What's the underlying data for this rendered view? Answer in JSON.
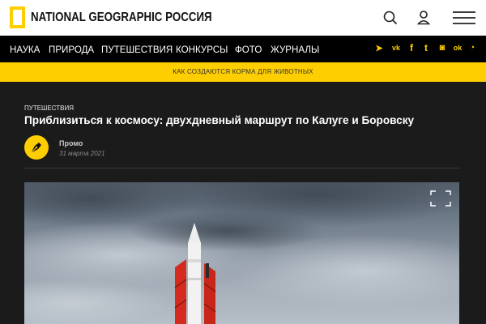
{
  "header": {
    "brand": "NATIONAL GEOGRAPHIC РОССИЯ",
    "brand_color": "#ffce00",
    "icons": [
      "search-icon",
      "user-icon",
      "menu-icon"
    ]
  },
  "nav": {
    "items": [
      "НАУКА",
      "ПРИРОДА",
      "ПУТЕШЕСТВИЯ",
      "КОНКУРСЫ",
      "ФОТО",
      "ЖУРНАЛЫ"
    ],
    "social_icons": [
      "telegram-icon",
      "vk-icon",
      "facebook-icon",
      "twitter-icon",
      "instagram-icon",
      "odnoklassniki-icon",
      "rss-icon"
    ],
    "social_glyphs": [
      "➤",
      "vk",
      "f",
      "t",
      "◙",
      "ok",
      "◔"
    ]
  },
  "promo": {
    "text": "КАК СОЗДАЮТСЯ КОРМА ДЛЯ ЖИВОТНЫХ"
  },
  "article": {
    "category": "ПУТЕШЕСТВИЯ",
    "title": "Приблизиться к космосу: двухдневный маршрут по Калуге и Боровску",
    "author": "Промо",
    "date": "31 марта 2021"
  },
  "hero": {
    "image": "rocket-monument-photo",
    "expand_icon": "fullscreen-icon"
  }
}
